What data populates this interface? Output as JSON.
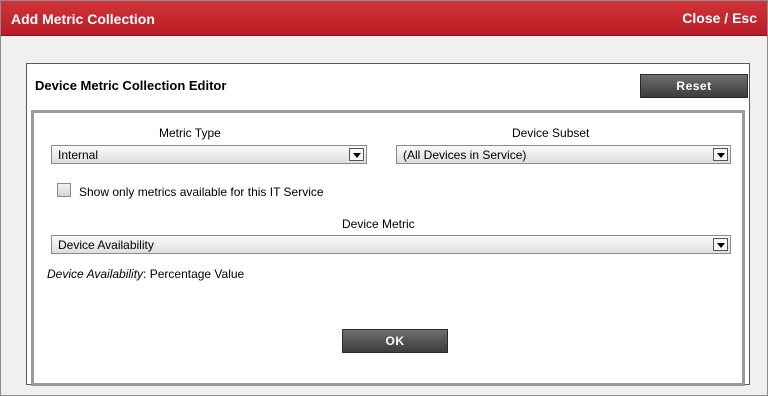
{
  "dialog": {
    "title": "Add Metric Collection",
    "close_label": "Close / Esc"
  },
  "editor": {
    "title": "Device Metric Collection Editor",
    "reset_label": "Reset",
    "metric_type": {
      "label": "Metric Type",
      "value": "Internal"
    },
    "device_subset": {
      "label": "Device Subset",
      "value": "(All Devices in Service)"
    },
    "checkbox_label": "Show only metrics available for this IT Service",
    "checkbox_checked": false,
    "device_metric": {
      "label": "Device Metric",
      "value": "Device Availability"
    },
    "description": {
      "name": "Device Availability",
      "text": ": Percentage Value"
    },
    "ok_label": "OK"
  },
  "colors": {
    "titlebar": "#c4262d",
    "button_dark": "#4a4a4a"
  }
}
